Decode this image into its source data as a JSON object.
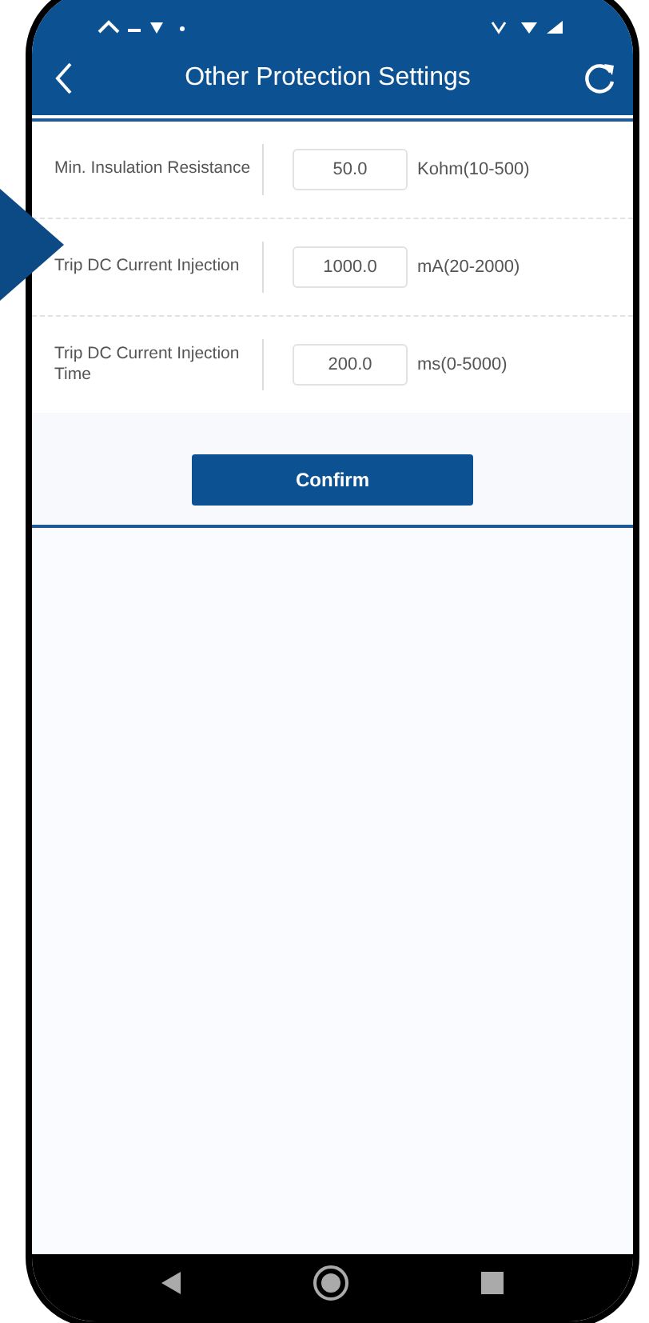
{
  "header": {
    "title": "Other Protection Settings"
  },
  "settings": [
    {
      "label": "Min. Insulation Resistance",
      "value": "50.0",
      "unit": "Kohm(10-500)"
    },
    {
      "label": "Trip DC Current Injection",
      "value": "1000.0",
      "unit": "mA(20-2000)"
    },
    {
      "label": "Trip DC Current Injection Time",
      "value": "200.0",
      "unit": "ms(0-5000)"
    }
  ],
  "confirm_button": {
    "label": "Confirm"
  }
}
